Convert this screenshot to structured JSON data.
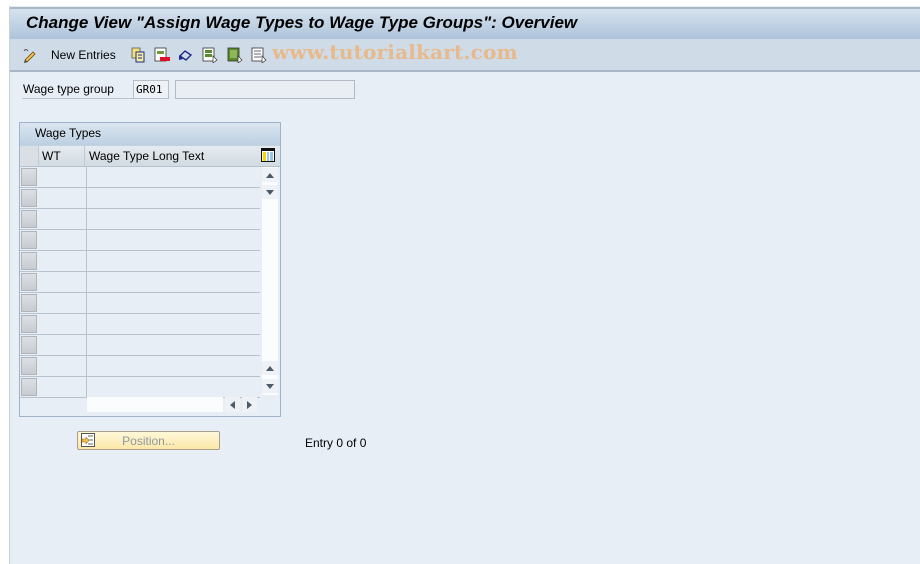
{
  "window": {
    "title": "Change View \"Assign Wage Types to Wage Type Groups\": Overview"
  },
  "toolbar": {
    "items": [
      {
        "icon": "edit-pencil-icon",
        "label": ""
      },
      {
        "icon": "new-entries",
        "label": "New Entries"
      },
      {
        "icon": "copy-icon",
        "label": ""
      },
      {
        "icon": "delete-icon",
        "label": ""
      },
      {
        "icon": "undo-icon",
        "label": ""
      },
      {
        "icon": "select-all-icon",
        "label": ""
      },
      {
        "icon": "select-block-icon",
        "label": ""
      },
      {
        "icon": "deselect-all-icon",
        "label": ""
      }
    ],
    "new_entries_label": "New Entries",
    "watermark": "www.tutorialkart.com"
  },
  "form": {
    "wage_type_group_label": "Wage type group",
    "wage_type_group_value": "GR01",
    "wage_type_group_desc": ""
  },
  "table": {
    "title": "Wage Types",
    "columns": [
      "WT",
      "Wage Type Long Text"
    ],
    "rows": [
      {
        "wt": "",
        "text": ""
      },
      {
        "wt": "",
        "text": ""
      },
      {
        "wt": "",
        "text": ""
      },
      {
        "wt": "",
        "text": ""
      },
      {
        "wt": "",
        "text": ""
      },
      {
        "wt": "",
        "text": ""
      },
      {
        "wt": "",
        "text": ""
      },
      {
        "wt": "",
        "text": ""
      },
      {
        "wt": "",
        "text": ""
      },
      {
        "wt": "",
        "text": ""
      },
      {
        "wt": "",
        "text": ""
      }
    ]
  },
  "footer": {
    "position_button": "Position...",
    "entry_status": "Entry 0 of 0"
  },
  "colors": {
    "background": "#e8eef6",
    "title_gradient_top": "#d6e2ee",
    "title_gradient_bottom": "#aec4da",
    "toolbar": "#cfdce7",
    "position_button": "#fbe8a8",
    "watermark": "#e8b98a"
  }
}
